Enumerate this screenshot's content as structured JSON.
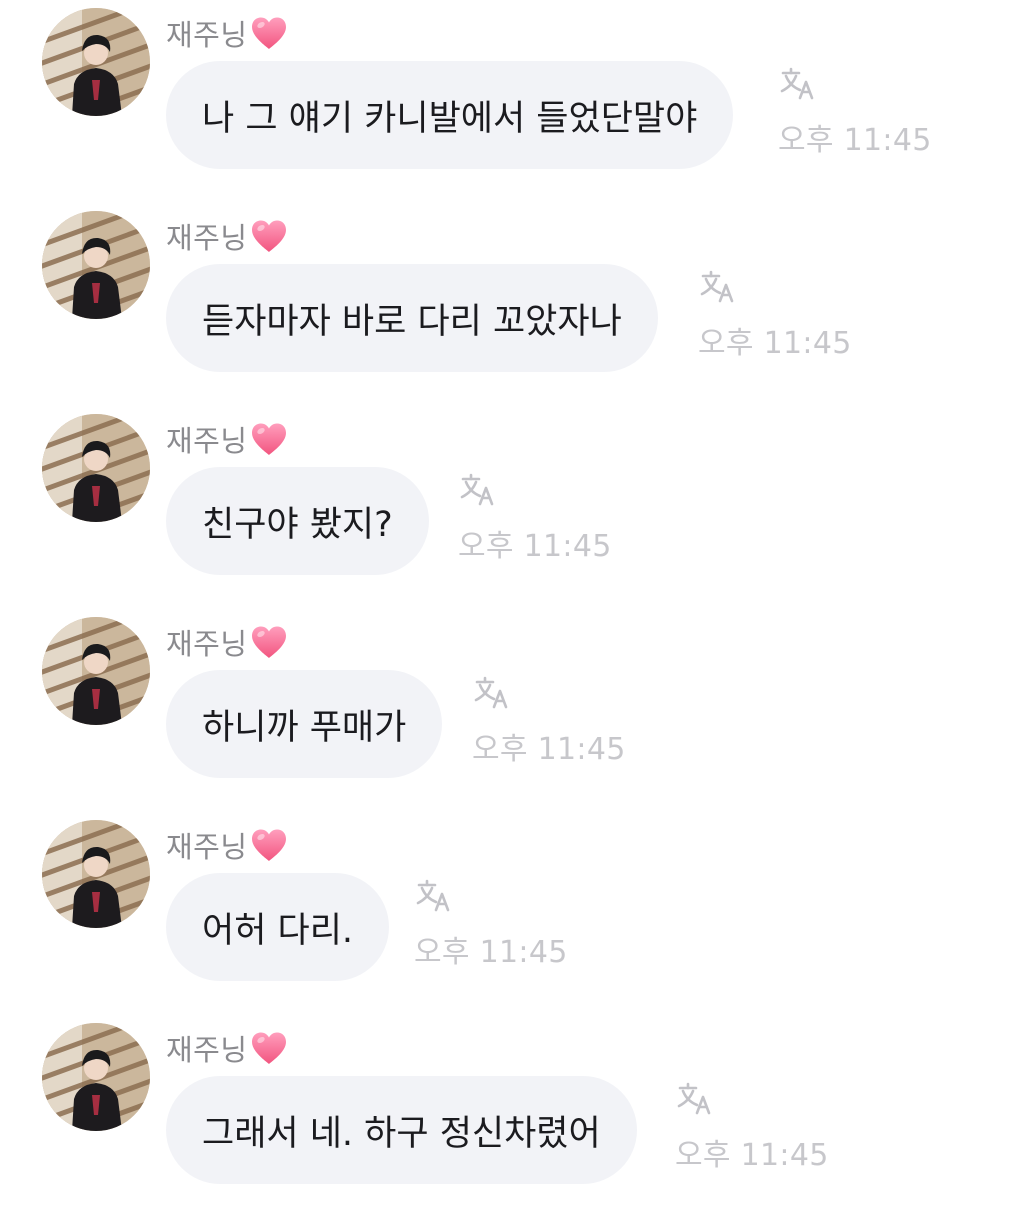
{
  "messages": [
    {
      "sender": "재주닝",
      "text": "나 그 얘기 카니발에서 들었단말야",
      "time": "오후 11:45",
      "translate_icon": "translate-icon",
      "heart_icon": "pink-heart-emoji"
    },
    {
      "sender": "재주닝",
      "text": "듣자마자 바로 다리 꼬았자나",
      "time": "오후 11:45",
      "translate_icon": "translate-icon",
      "heart_icon": "pink-heart-emoji"
    },
    {
      "sender": "재주닝",
      "text": "친구야 봤지?",
      "time": "오후 11:45",
      "translate_icon": "translate-icon",
      "heart_icon": "pink-heart-emoji"
    },
    {
      "sender": "재주닝",
      "text": "하니까 푸매가",
      "time": "오후 11:45",
      "translate_icon": "translate-icon",
      "heart_icon": "pink-heart-emoji"
    },
    {
      "sender": "재주닝",
      "text": "어허 다리.",
      "time": "오후 11:45",
      "translate_icon": "translate-icon",
      "heart_icon": "pink-heart-emoji"
    },
    {
      "sender": "재주닝",
      "text": "그래서 네. 하구 정신차렸어",
      "time": "오후 11:45",
      "translate_icon": "translate-icon",
      "heart_icon": "pink-heart-emoji"
    }
  ],
  "colors": {
    "background": "#ffffff",
    "bubble": "#f2f3f7",
    "message_text": "#1b1b1f",
    "sender_name": "#8a8a8e",
    "timestamp": "#c7c7cb",
    "heart": "#ff6f9c"
  }
}
